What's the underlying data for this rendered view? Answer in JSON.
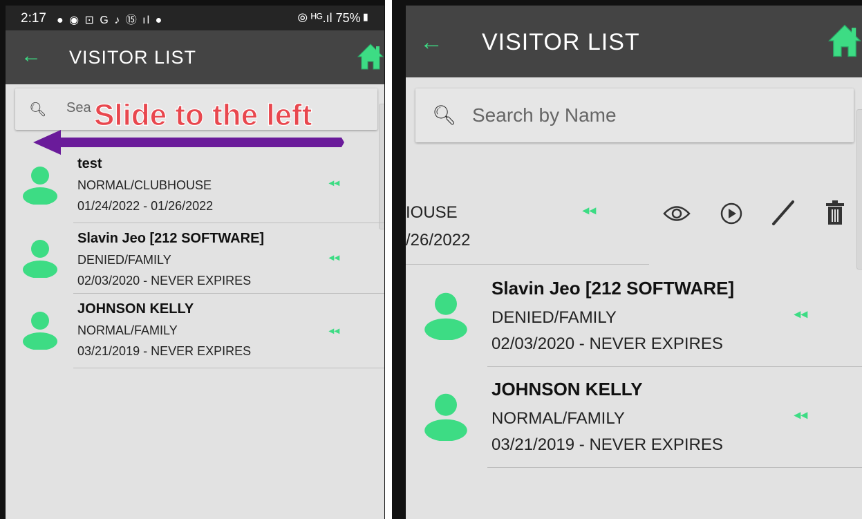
{
  "left": {
    "status": {
      "time": "2:17",
      "icons": "● ◉ ⊡ G ♪ ⑮ ıl ●",
      "right": "⦾ ᴴᴳ.ıl 75%▮"
    },
    "appbar": {
      "title": "VISITOR LIST",
      "back_icon": "arrow-left-icon",
      "home_icon": "home-icon"
    },
    "search": {
      "value": "Sea",
      "icon": "search-icon"
    },
    "annotation": {
      "text": "Slide to the left",
      "color": "#e8474e",
      "arrow_color": "#6a1b9a"
    },
    "rows": [
      {
        "name": "test",
        "type": "NORMAL/CLUBHOUSE",
        "dates": "01/24/2022 - 01/26/2022",
        "chevrons": "◂◂"
      },
      {
        "name": "Slavin Jeo [212 SOFTWARE]",
        "type": "DENIED/FAMILY",
        "dates": "02/03/2020 - NEVER EXPIRES",
        "chevrons": "◂◂"
      },
      {
        "name": "JOHNSON KELLY",
        "type": "NORMAL/FAMILY",
        "dates": "03/21/2019 - NEVER EXPIRES",
        "chevrons": "◂◂"
      }
    ]
  },
  "right": {
    "appbar": {
      "title": "VISITOR LIST"
    },
    "search": {
      "placeholder": "Search by Name"
    },
    "swiped_row": {
      "line2": "IOUSE",
      "line3": "/26/2022",
      "chevrons": "◂◂",
      "actions": [
        "eye-icon",
        "play-circle-icon",
        "pencil-icon",
        "trash-icon"
      ]
    },
    "rows": [
      {
        "name": "Slavin Jeo [212 SOFTWARE]",
        "type": "DENIED/FAMILY",
        "dates": "02/03/2020 - NEVER EXPIRES",
        "chevrons": "◂◂"
      },
      {
        "name": "JOHNSON KELLY",
        "type": "NORMAL/FAMILY",
        "dates": "03/21/2019 - NEVER EXPIRES",
        "chevrons": "◂◂"
      }
    ]
  },
  "colors": {
    "accent_green": "#3ddc84",
    "appbar": "#444444",
    "background": "#e2e2e2"
  }
}
